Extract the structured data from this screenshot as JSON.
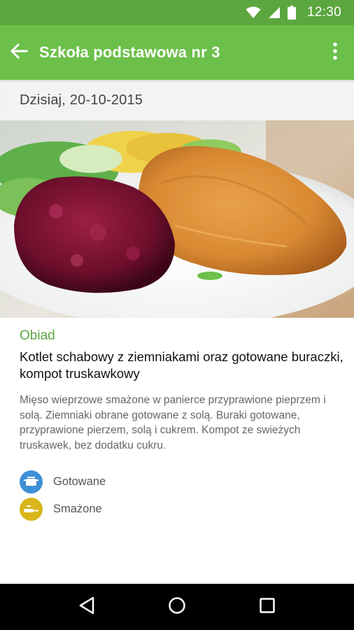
{
  "status_bar": {
    "time": "12:30",
    "icons": [
      "wifi-icon",
      "signal-icon",
      "battery-icon"
    ]
  },
  "app_bar": {
    "title": "Szkoła podstawowa nr 3",
    "back_icon": "arrow-left-icon",
    "menu_icon": "more-vertical-icon",
    "color": "#6cc04a"
  },
  "date_bar": {
    "text": "Dzisiaj, 20-10-2015"
  },
  "meal": {
    "type": "Obiad",
    "name": "Kotlet schabowy z ziemniakami oraz gotowane buraczki, kompot truskawkowy",
    "description": "Mięso wieprzowe smażone w panierce przyprawione pieprzem i solą. Ziemniaki obrane gotowane z solą. Buraki gotowane, przyprawione pierzem, solą i cukrem. Kompot ze swieżych truskawek, bez dodatku cukru.",
    "tags": [
      {
        "label": "Gotowane",
        "icon": "pot-icon",
        "color": "#3d8fd6"
      },
      {
        "label": "Smażone",
        "icon": "frying-pan-icon",
        "color": "#d9b51a"
      }
    ]
  },
  "nav_bar": {
    "icons": [
      "back-triangle-icon",
      "home-circle-icon",
      "recents-square-icon"
    ]
  },
  "colors": {
    "status_bar": "#5ba63f",
    "accent": "#5ba63f"
  }
}
